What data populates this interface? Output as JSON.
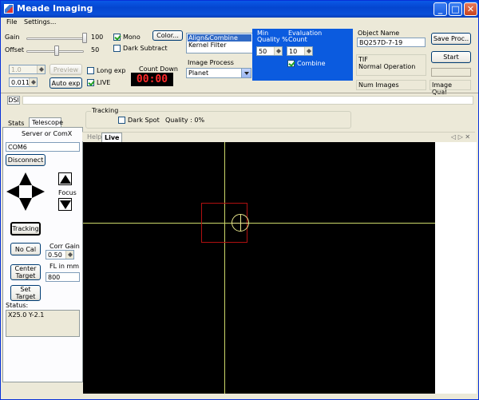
{
  "window": {
    "title": "Meade Imaging",
    "controls": {
      "minimize": "_",
      "maximize": "□",
      "close": "✕"
    }
  },
  "menu": {
    "file": "File",
    "settings": "Settings..."
  },
  "camera": {
    "gain_label": "Gain",
    "gain_value": "100",
    "offset_label": "Offset",
    "offset_value": "50",
    "mono_label": "Mono",
    "mono_checked": true,
    "color_button": "Color...",
    "dark_subtract_label": "Dark Subtract",
    "dark_subtract_checked": false,
    "exposure_value": "1.0",
    "exposure_step_value": "0.0110",
    "preview_button": "Preview",
    "auto_exp_button": "Auto exp",
    "long_exp_label": "Long exp",
    "long_exp_checked": false,
    "live_label": "LIVE",
    "live_checked": true,
    "countdown_label": "Count Down",
    "countdown_value": "00:00"
  },
  "process": {
    "list_items": [
      "Align&Combine",
      "Kernel Filter"
    ],
    "selected_item": "Align&Combine",
    "image_process_label": "Image Process",
    "image_process_value": "Planet"
  },
  "evaluation": {
    "min_quality_label_1": "Min",
    "min_quality_label_2": "Quality %",
    "min_quality_value": "50",
    "eval_count_label_1": "Evaluation",
    "eval_count_label_2": "Count",
    "eval_count_value": "10",
    "combine_label": "Combine",
    "combine_checked": true
  },
  "object": {
    "name_label": "Object Name",
    "name_value": "BQ257D-7-19",
    "save_button": "Save Proc..",
    "start_button": "Start",
    "format": "TIF",
    "status": "Normal Operation",
    "num_images_label": "Num Images",
    "image_qual_label": "Image Qual"
  },
  "dsi_tab": "DSI",
  "tracking_group": {
    "label": "Tracking",
    "dark_spot_label": "Dark Spot",
    "dark_spot_checked": false,
    "quality_label": "Quality : 0%"
  },
  "left_tabs": {
    "stats": "Stats",
    "telescope": "Telescope"
  },
  "telescope": {
    "server_label": "Server or ComX",
    "com_value": "COM6",
    "disconnect_button": "Disconnect",
    "focus_label": "Focus",
    "tracking_button": "Tracking",
    "no_cal_button": "No Cal",
    "corr_gain_label": "Corr Gain",
    "corr_gain_value": "0.50",
    "center_target_button": "Center Target",
    "fl_label": "FL in mm",
    "fl_value": "800",
    "set_target_button": "Set Target",
    "status_label": "Status:",
    "status_value": "X25.0 Y-2.1"
  },
  "viewer_tabs": {
    "help": "Help",
    "live": "Live",
    "nav": "◁ ▷ ✕"
  },
  "colors": {
    "title_blue": "#0446d0",
    "panel_blue": "#0b5bdf",
    "countdown_bg": "#000000",
    "countdown_fg": "#ff2a2a",
    "crosshair": "#ccd86a",
    "target_box": "#b01010"
  }
}
